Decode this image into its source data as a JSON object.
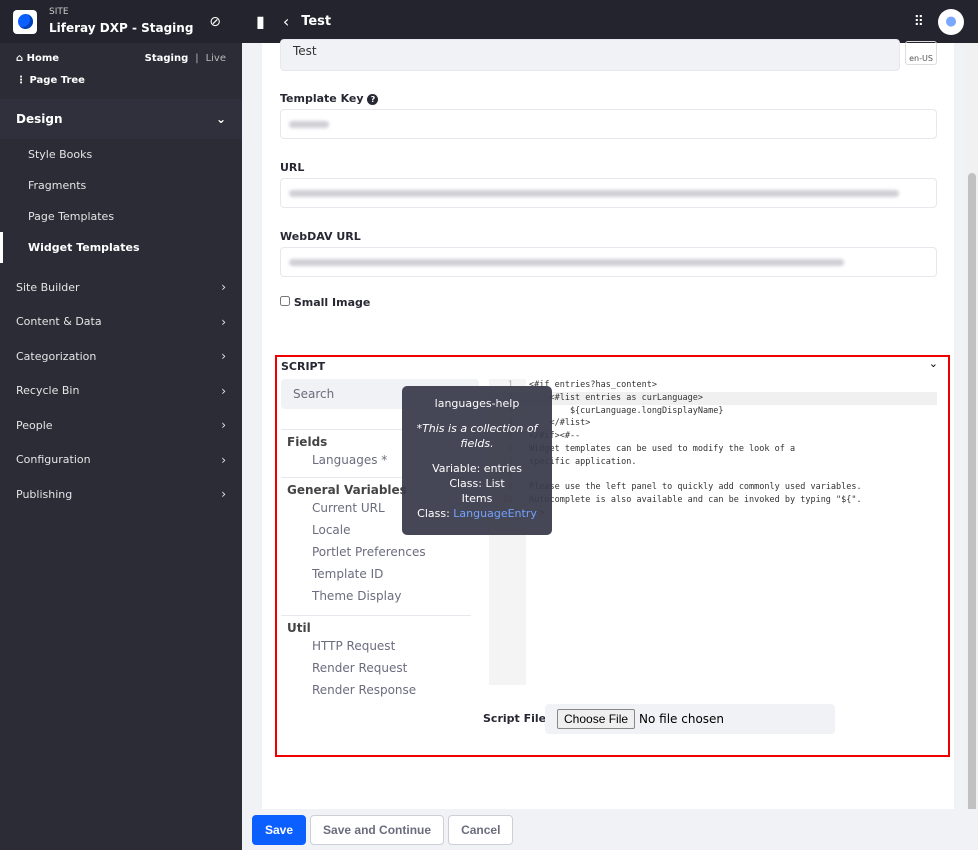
{
  "site": {
    "label": "SITE",
    "name": "Liferay DXP - Staging"
  },
  "nav": {
    "home": "Home",
    "staging": "Staging",
    "separator": "|",
    "live": "Live",
    "page_tree": "Page Tree"
  },
  "sidebar": {
    "design": "Design",
    "design_items": [
      "Style Books",
      "Fragments",
      "Page Templates",
      "Widget Templates"
    ],
    "sections": [
      "Site Builder",
      "Content & Data",
      "Categorization",
      "Recycle Bin",
      "People",
      "Configuration",
      "Publishing"
    ]
  },
  "topbar": {
    "title": "Test"
  },
  "form": {
    "name_value": "Test",
    "locale": "en-US",
    "template_key_label": "Template Key",
    "url_label": "URL",
    "webdav_label": "WebDAV URL",
    "small_image_label": "Small Image"
  },
  "script": {
    "title": "SCRIPT",
    "search_placeholder": "Search",
    "groups": [
      {
        "title": "Fields",
        "items": [
          "Languages *"
        ]
      },
      {
        "title": "General Variables",
        "items": [
          "Current URL",
          "Locale",
          "Portlet Preferences",
          "Template ID",
          "Theme Display"
        ]
      },
      {
        "title": "Util",
        "items": [
          "HTTP Request",
          "Render Request",
          "Render Response"
        ]
      }
    ],
    "code": [
      "<#if entries?has_content>",
      "    <#list entries as curLanguage>",
      "        ${curLanguage.longDisplayName}",
      "    </#list>",
      "</#if><#--",
      "Widget templates can be used to modify the look of a",
      "specific application.",
      "",
      "Please use the left panel to quickly add commonly used variables.",
      "Autocomplete is also available and can be invoked by typing \"${\".",
      "-->"
    ],
    "script_file_label": "Script File",
    "choose_file": "Choose File",
    "no_file": "No file chosen"
  },
  "tooltip": {
    "title": "languages-help",
    "desc": "*This is a collection of fields.",
    "variable": "Variable:  entries",
    "class": "Class:  List",
    "items": "Items",
    "items_class_label": "Class:",
    "items_class": "LanguageEntry"
  },
  "footer": {
    "save": "Save",
    "save_continue": "Save and Continue",
    "cancel": "Cancel"
  }
}
